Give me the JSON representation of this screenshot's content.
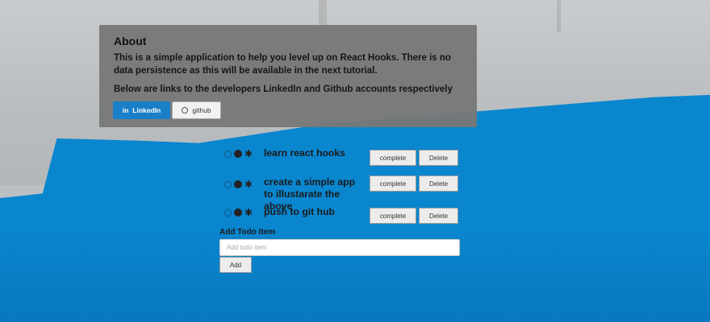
{
  "about": {
    "title": "About",
    "description": "This is a simple application to help you level up on React Hooks. There is no data persistence as this will be available in the next tutorial.",
    "links_text": "Below are links to the developers LinkedIn and Github accounts respectively",
    "linkedin_label": "LinkedIn",
    "linkedin_icon_text": "in",
    "github_label": "github"
  },
  "todos": [
    {
      "text": "learn react hooks",
      "complete_label": "complete",
      "delete_label": "Delete"
    },
    {
      "text": "create a simple app to illustarate the above",
      "complete_label": "complete",
      "delete_label": "Delete"
    },
    {
      "text": "push to git hub",
      "complete_label": "complete",
      "delete_label": "Delete"
    }
  ],
  "add_form": {
    "label": "Add Todo Item",
    "placeholder": "Add todo item",
    "button_label": "Add"
  },
  "colors": {
    "background_blue": "#0a86cf",
    "panel_grey": "#787878",
    "linkedin_blue": "#1a7fc9"
  }
}
